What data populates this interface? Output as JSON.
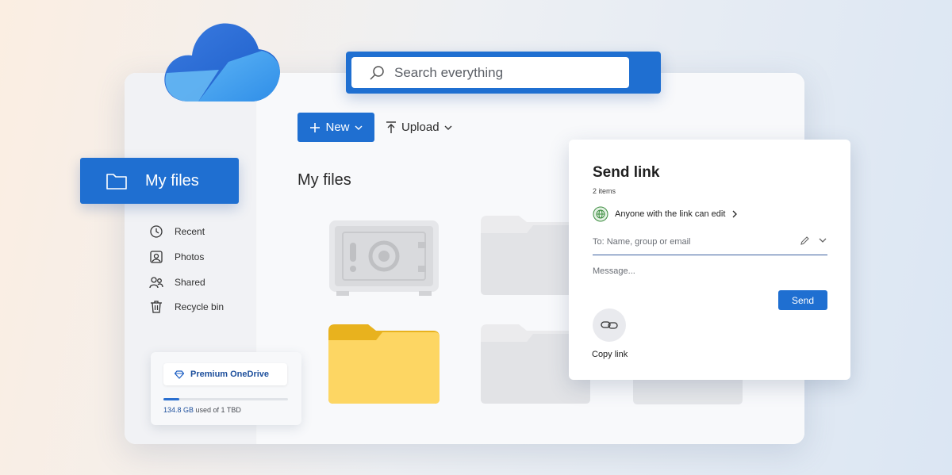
{
  "search": {
    "placeholder": "Search everything"
  },
  "toolbar": {
    "new_label": "New",
    "upload_label": "Upload"
  },
  "main": {
    "title": "My files"
  },
  "sidebar": {
    "selected_label": "My files",
    "items": [
      {
        "label": "Recent",
        "icon": "history-icon"
      },
      {
        "label": "Photos",
        "icon": "photo-icon"
      },
      {
        "label": "Shared",
        "icon": "people-icon"
      },
      {
        "label": "Recycle bin",
        "icon": "trash-icon"
      }
    ]
  },
  "premium": {
    "label": "Premium OneDrive",
    "storage_used": "134.8 GB",
    "storage_suffix": " used of 1 TBD",
    "storage_fraction": 0.13
  },
  "send_link": {
    "title": "Send link",
    "subtitle": "2 items",
    "permission": "Anyone with the link can edit",
    "to_placeholder": "To: Name, group or email",
    "message_placeholder": "Message...",
    "send_label": "Send",
    "copy_label": "Copy link"
  },
  "colors": {
    "accent": "#1f6fd1",
    "folder": "#fdd663"
  }
}
